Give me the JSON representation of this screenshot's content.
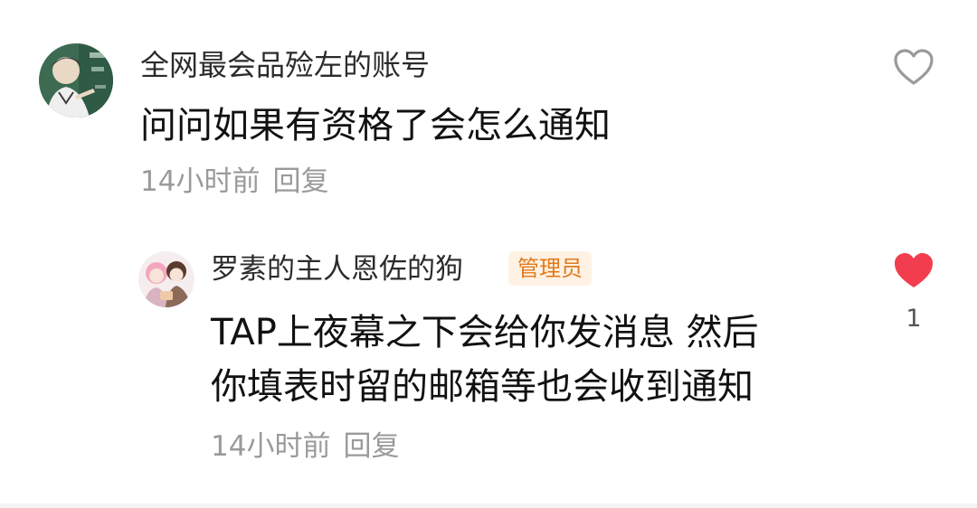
{
  "comments": [
    {
      "username": "全网最会品殓左的账号",
      "content": "问问如果有资格了会怎么通知",
      "time": "14小时前",
      "reply_label": "回复",
      "liked": false
    },
    {
      "username": "罗素的主人恩佐的狗",
      "badge": "管理员",
      "content_lines": [
        "TAP上夜幕之下会给你发消息 然后",
        "你填表时留的邮箱等也会收到通知"
      ],
      "time": "14小时前",
      "reply_label": "回复",
      "liked": true,
      "like_count": "1"
    }
  ],
  "colors": {
    "like_active": "#f23d4f",
    "like_inactive": "#9a9a9a",
    "badge_bg": "#fff1e3",
    "badge_text": "#e07a1c",
    "meta_text": "#9a9a9a"
  },
  "icons": {
    "like_outline": "heart-outline-icon",
    "like_filled": "heart-filled-icon"
  }
}
